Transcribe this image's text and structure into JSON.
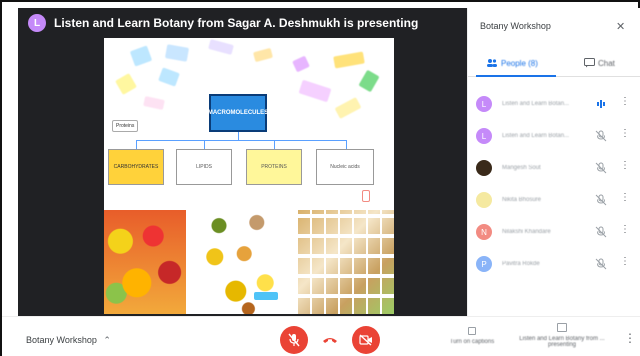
{
  "presenting": {
    "initial": "L",
    "text": "Listen and Learn Botany from Sagar A. Deshmukh is presenting"
  },
  "slide": {
    "center_label": "MACROMOLECULES",
    "boxes": [
      "CARBOHYDRATES",
      "LIPIDS",
      "PROTEINS",
      "Nucleic acids"
    ],
    "small_note": "Proteins"
  },
  "footer": {
    "meeting_name": "Botany Workshop",
    "captions_label": "Turn on captions",
    "presenting_label": "Listen and Learn Botany from ... presenting"
  },
  "panel": {
    "title": "Botany Workshop",
    "tab_people": "People (8)",
    "tab_chat": "Chat",
    "participants": [
      {
        "initial": "L",
        "name": "Listen and Learn Botan...",
        "color": "#c58af9"
      },
      {
        "initial": "L",
        "name": "Listen and Learn Botan...",
        "color": "#c58af9"
      },
      {
        "initial": "",
        "name": "Mangesh Sout",
        "color": "#3a2a1a"
      },
      {
        "initial": "",
        "name": "Nikita Bhosure",
        "color": "#f5e9a0"
      },
      {
        "initial": "N",
        "name": "Nilakshi Khandare",
        "color": "#f28b82"
      },
      {
        "initial": "P",
        "name": "Pavitra Rokde",
        "color": "#8ab4f8"
      }
    ]
  },
  "colors": {
    "accent": "#1a73e8",
    "end_call": "#ea4335",
    "avatar_purple": "#c58af9"
  }
}
